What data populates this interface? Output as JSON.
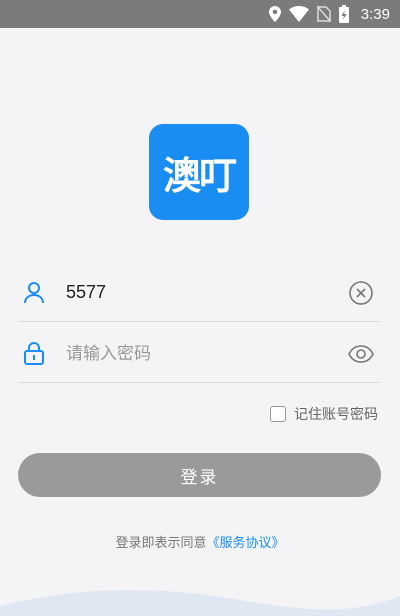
{
  "status_bar": {
    "time": "3:39",
    "icons": [
      "location-icon",
      "wifi-icon",
      "no-sim-icon",
      "battery-charging-icon"
    ]
  },
  "logo": {
    "text": "澳叮",
    "color": "#1a8df2"
  },
  "form": {
    "username": {
      "value": "5577",
      "leading_icon": "user-icon",
      "trailing_icon": "clear-icon"
    },
    "password": {
      "value": "",
      "placeholder": "请输入密码",
      "leading_icon": "lock-icon",
      "trailing_icon": "eye-icon"
    },
    "remember_label": "记住账号密码",
    "remember_checked": false,
    "login_label": "登录"
  },
  "agreement": {
    "prefix": "登录即表示同意",
    "link": "《服务协议》"
  },
  "colors": {
    "accent": "#1a8df2",
    "button_disabled": "#9a9a9a",
    "status_bar": "#7b7b7b"
  }
}
